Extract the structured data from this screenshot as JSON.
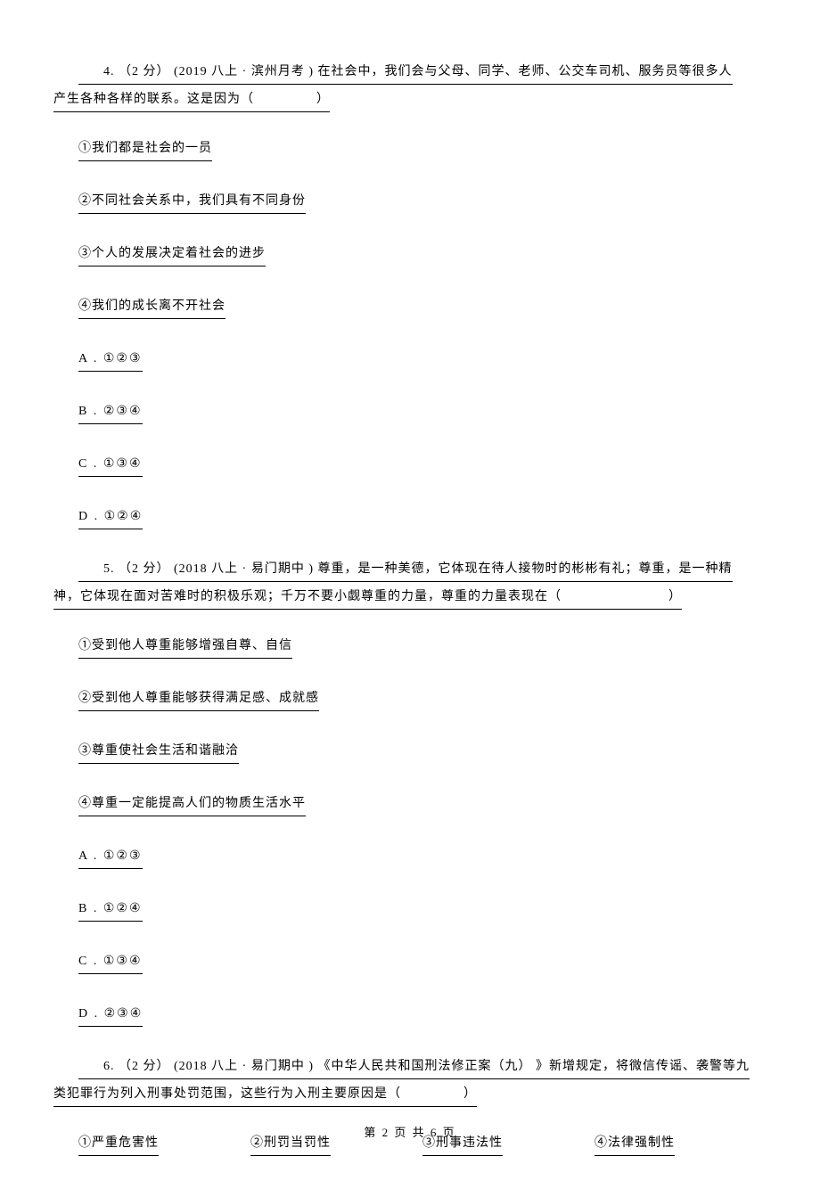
{
  "q4": {
    "num": "4.",
    "points": "（2 分）",
    "source": "(2019  八上 · 滨州月考  )",
    "stem": "在社会中，我们会与父母、同学、老师、公交车司机、服务员等很多人",
    "stem2": "产生各种各样的联系。这是因为（",
    "stem3": "）",
    "s1": "①我们都是社会的一员",
    "s2": "②不同社会关系中，我们具有不同身份",
    "s3": "③个人的发展决定着社会的进步",
    "s4": "④我们的成长离不开社会",
    "a": "A .  ①②③",
    "b": "B .  ②③④",
    "c": "C .  ①③④",
    "d": "D .  ①②④"
  },
  "q5": {
    "num": "5.",
    "points": "（2 分）",
    "source": "(2018  八上 · 易门期中  )",
    "stem": "尊重，是一种美德，它体现在待人接物时的彬彬有礼；尊重，是一种精",
    "stem2": "神，它体现在面对苦难时的积极乐观；千万不要小觑尊重的力量，尊重的力量表现在（",
    "stem3": "）",
    "s1": "①受到他人尊重能够增强自尊、自信",
    "s2": "②受到他人尊重能够获得满足感、成就感",
    "s3": "③尊重使社会生活和谐融洽",
    "s4": "④尊重一定能提高人们的物质生活水平",
    "a": "A .  ①②③",
    "b": "B .  ①②④",
    "c": "C .  ①③④",
    "d": "D .  ②③④"
  },
  "q6": {
    "num": "6.",
    "points": "（2 分）",
    "source": "(2018  八上 · 易门期中  )",
    "stem": "《中华人民共和国刑法修正案（九）   》新增规定，将微信传谣、袭警等九",
    "stem2": "类犯罪行为列入刑事处罚范围，这些行为入刑主要原因是（",
    "stem3": "）",
    "r1": "①严重危害性",
    "r2": "②刑罚当罚性",
    "r3": "③刑事违法性",
    "r4": "④法律强制性"
  },
  "footer": "第 2 页 共 6 页"
}
